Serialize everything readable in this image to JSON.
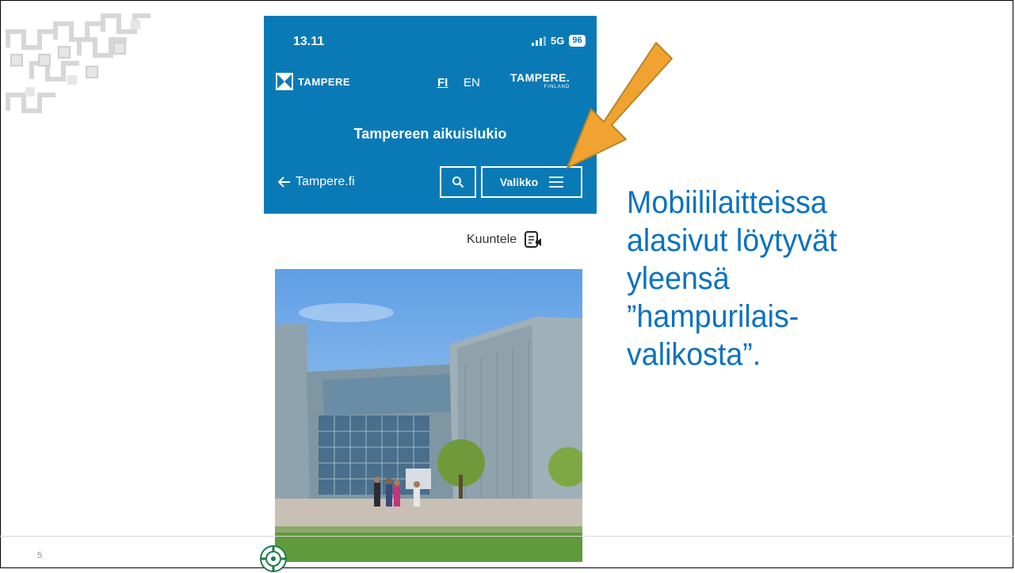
{
  "slide": {
    "number": "5",
    "text": "Mobiililaitteissa\nalasivut löytyvät\nyleensä\n”hampurilais-\nvalikosta”."
  },
  "phone": {
    "status_bar": {
      "time": "13.11",
      "network": "5G",
      "battery": "96"
    },
    "header": {
      "logo_text": "TAMPERE",
      "lang_fi": "FI",
      "lang_en": "EN",
      "brand_main": "TAMPERE.",
      "brand_sub": "FINLAND",
      "site_title": "Tampereen aikuislukio",
      "back_link": "Tampere.fi",
      "menu_label": "Valikko"
    },
    "listen_label": "Kuuntele"
  },
  "icons": [
    "back-arrow-icon",
    "search-icon",
    "hamburger-menu-icon",
    "listen-audio-icon",
    "signal-icon",
    "cookie-settings-icon",
    "annotation-arrow-icon"
  ],
  "colors": {
    "header_blue": "#0a7ab6",
    "text_blue": "#0a72c0",
    "arrow_orange": "#f0a330"
  }
}
